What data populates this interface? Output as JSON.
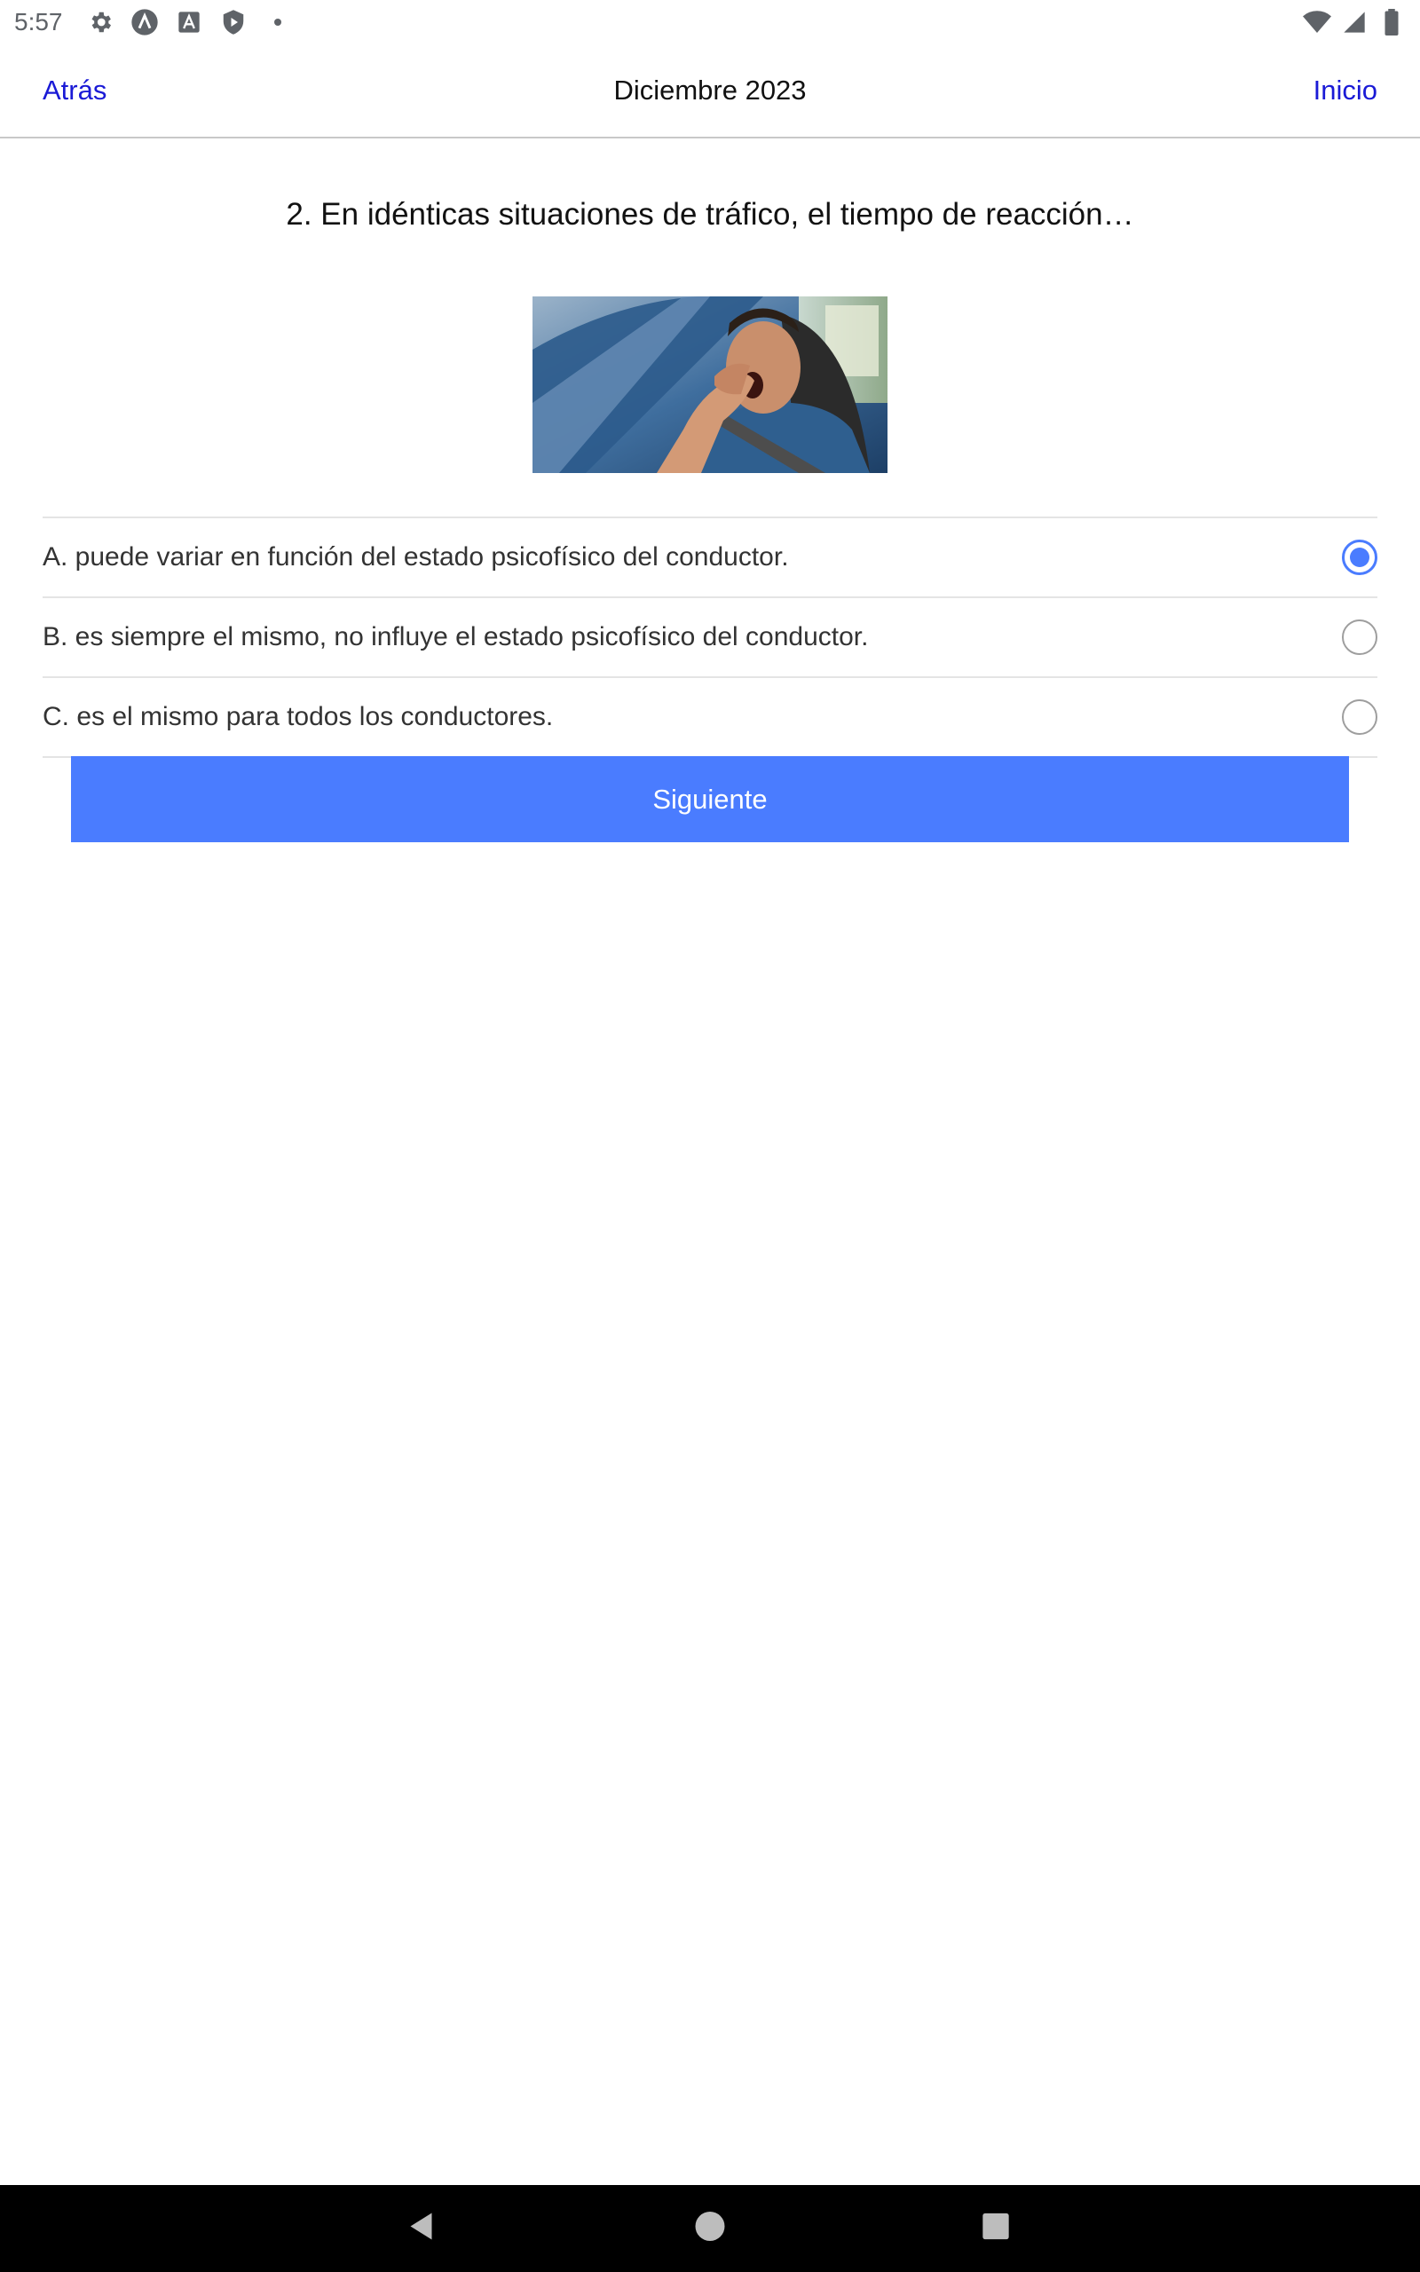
{
  "status_bar": {
    "time": "5:57",
    "left_icons": [
      "gear-icon",
      "android-a-icon",
      "a-box-icon",
      "shield-play-icon",
      "dot-icon"
    ],
    "right_icons": [
      "wifi-icon",
      "signal-icon",
      "battery-icon"
    ]
  },
  "header": {
    "back_label": "Atrás",
    "title": "Diciembre 2023",
    "home_label": "Inicio",
    "link_color": "#1a1ad6"
  },
  "question": {
    "text": "2. En idénticas situaciones de tráfico, el tiempo de reacción…"
  },
  "options": [
    {
      "label": "A. puede variar en función del estado psicofísico del conductor.",
      "selected": true
    },
    {
      "label": "B. es siempre el mismo, no influye el estado psicofísico del conductor.",
      "selected": false
    },
    {
      "label": "C. es el mismo para todos los conductores.",
      "selected": false
    }
  ],
  "next_button": {
    "label": "Siguiente",
    "color": "#4a7cff"
  },
  "nav_bar": {
    "icons": [
      "back-triangle-icon",
      "home-circle-icon",
      "recents-square-icon"
    ]
  }
}
